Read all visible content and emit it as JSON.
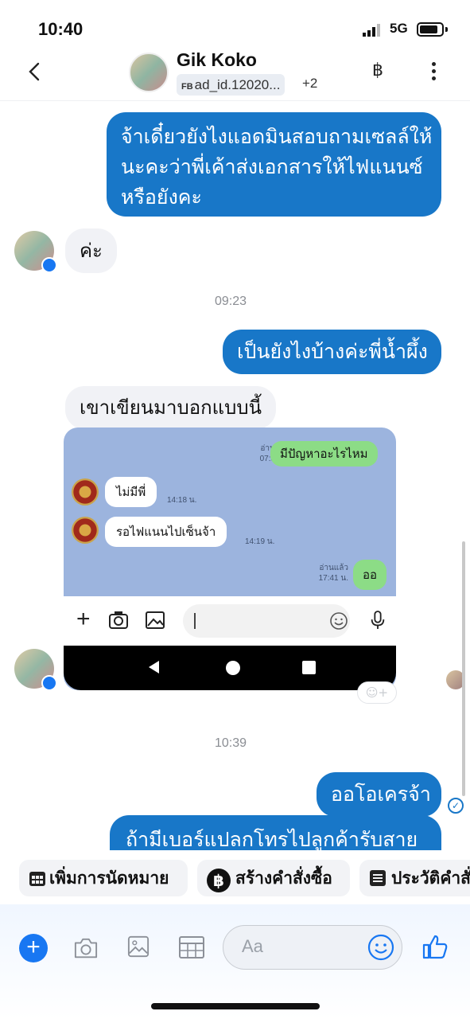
{
  "status_bar": {
    "time": "10:40",
    "network": "5G"
  },
  "header": {
    "name": "Gik Koko",
    "tag_prefix": "FB",
    "tag": "ad_id.12020...",
    "tag_extra": "+2",
    "currency_symbol": "฿"
  },
  "messages": {
    "out1": [
      "จ้าเดี๋ยวยังไงแอดมินสอบถามเซลล์ให้",
      "นะคะว่าพี่เค้าส่งเอกสารให้ไฟแนนซ์",
      "หรือยังคะ"
    ],
    "in1": "ค่ะ",
    "time1": "09:23",
    "out2": "เป็นยังไงบ้างค่ะพี่น้ำผึ้ง",
    "in2": "เขาเขียนมาบอกแบบนี้",
    "time2": "10:39",
    "out3": "ออโอเครจ้า",
    "out4": "ถ้ามีเบอร์แปลกโทรไปลูกค้ารับสาย"
  },
  "embedded_chat": {
    "msg1": {
      "text": "มีปัญหาอะไรไหม",
      "read": "อ่านแล้ว",
      "time": "07:57 น."
    },
    "msg2": {
      "text": "ไม่มีพี่",
      "time": "14:18 น."
    },
    "msg3": {
      "text": "รอไฟแนนไปเซ็นจ้า",
      "time": "14:19 น."
    },
    "msg4": {
      "text": "ออ",
      "read": "อ่านแล้ว",
      "time": "17:41 น."
    }
  },
  "quick_actions": [
    {
      "label": "เพิ่มการนัดหมาย",
      "icon": "calendar-icon"
    },
    {
      "label": "สร้างคำสั่งซื้อ",
      "icon": "baht-icon"
    },
    {
      "label": "ประวัติคำสั่งซื้อ",
      "icon": "list-icon"
    }
  ],
  "composer": {
    "placeholder": "Aa"
  },
  "colors": {
    "accent": "#1877c8",
    "messenger_blue": "#1877f2",
    "line_green": "#8cdc86",
    "line_bg": "#9cb4de"
  }
}
